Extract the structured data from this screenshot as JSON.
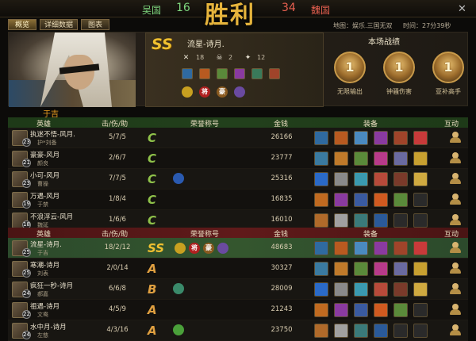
{
  "topbar": {
    "left_team": "吴国",
    "left_score": "16",
    "right_score": "34",
    "right_team": "魏国",
    "title_glyph": "胜利"
  },
  "tabs": [
    {
      "label": "概览"
    },
    {
      "label": "详细数据"
    },
    {
      "label": "图表"
    }
  ],
  "map_info": "地图：娱乐.三国无双",
  "time_info": "时间：27分39秒",
  "hero": {
    "grade": "SS",
    "name": "流星-诗月.",
    "stats": [
      "18",
      "2",
      "12"
    ],
    "badge_labels": [
      "将",
      "豪"
    ],
    "record_title": "本场战绩",
    "medals": [
      {
        "num": "1",
        "label": "无限输出"
      },
      {
        "num": "1",
        "label": "钟骚伤害"
      },
      {
        "num": "1",
        "label": "亚补高手"
      }
    ]
  },
  "team_label": "于吉",
  "headers": {
    "hero": "英雄",
    "kda": "击/伤/助",
    "honor": "荣誉称号",
    "money": "金钱",
    "equip": "装备",
    "interact": "互动"
  },
  "team1": [
    {
      "name": "执迷不悟-风月.",
      "sub": "护*刘备",
      "level": "23",
      "kda": "5/7/5",
      "grade": "C",
      "money": "26166"
    },
    {
      "name": "豪豪-风月",
      "sub": "颜良",
      "level": "21",
      "kda": "2/6/7",
      "grade": "C",
      "money": "23777"
    },
    {
      "name": "小可-风月",
      "sub": "曹操",
      "level": "23",
      "kda": "7/7/5",
      "grade": "C",
      "money": "25316"
    },
    {
      "name": "万遇-风月",
      "sub": "于禁",
      "level": "19",
      "kda": "1/8/4",
      "grade": "C",
      "money": "16835"
    },
    {
      "name": "不浪浮云-风月",
      "sub": "魏延",
      "level": "18",
      "kda": "1/6/6",
      "grade": "C",
      "money": "16010"
    }
  ],
  "team2": [
    {
      "name": "流星-诗月.",
      "sub": "于吉",
      "level": "25",
      "kda": "18/2/12",
      "grade": "SS",
      "money": "48683",
      "honor_text": [
        "将",
        "豪"
      ]
    },
    {
      "name": "寒潮-诗月",
      "sub": "刘表",
      "level": "25",
      "kda": "2/0/14",
      "grade": "A",
      "money": "30327"
    },
    {
      "name": "疯狂一秒-诗月",
      "sub": "郝嘉",
      "level": "24",
      "kda": "6/6/8",
      "grade": "B",
      "money": "28009"
    },
    {
      "name": "祖遇-诗月",
      "sub": "文鸯",
      "level": "22",
      "kda": "4/5/9",
      "grade": "A",
      "money": "21243"
    },
    {
      "name": "水中月-诗月",
      "sub": "左慈",
      "level": "24",
      "kda": "4/3/16",
      "grade": "A",
      "money": "23750"
    }
  ],
  "colors": {
    "left_team": "#7ed67e",
    "right_team": "#e86050",
    "title": "#e6b43c",
    "grade_c": "#8fc24a",
    "grade_a": "#e0a040",
    "grade_b": "#e0a040",
    "grade_ss": "#f0c030"
  }
}
